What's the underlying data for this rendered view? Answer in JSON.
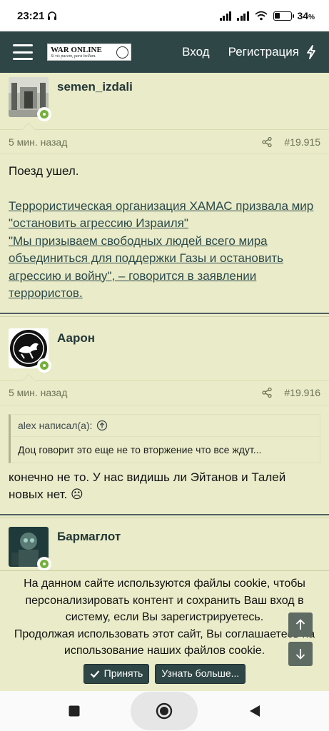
{
  "status_bar": {
    "time": "23:21",
    "battery": "34",
    "battery_unit": "%",
    "battery_level": 0.34
  },
  "header": {
    "logo_title": "WAR ONLINE",
    "logo_motto": "Si vis pacem, para bellum.",
    "login": "Вход",
    "register": "Регистрация"
  },
  "posts": [
    {
      "username": "semen_izdali",
      "time": "5 мин. назад",
      "number": "#19.915",
      "text1": "Поезд ушел.",
      "link1": "Террористическая организация ХАМАС призвала мир \"остановить агрессию Израиля\"",
      "link2": "\"Мы призываем свободных людей всего мира объединиться для поддержки Газы и остановить агрессию и войну\", – говорится в заявлении террористов."
    },
    {
      "username": "Аарон",
      "time": "5 мин. назад",
      "number": "#19.916",
      "quote_author": "alex написал(а):",
      "quote_text": "Доц говорит это еще не то вторжение что все ждут...",
      "text": "конечно не то. У нас видишь ли Эйтанов и Талей новых нет. ☹"
    },
    {
      "username": "Бармаглот"
    }
  ],
  "cookie": {
    "line1": "На данном сайте используются файлы cookie, чтобы персонализировать контент и сохранить Ваш вход в систему, если Вы зарегистрируетесь.",
    "line2": "Продолжая использовать этот сайт, Вы соглашаетесь на использование наших файлов cookie.",
    "accept": "Принять",
    "learn_more": "Узнать больше..."
  },
  "colors": {
    "header": "#2f4646",
    "background": "#e9ebc9",
    "online": "#74b03a"
  }
}
